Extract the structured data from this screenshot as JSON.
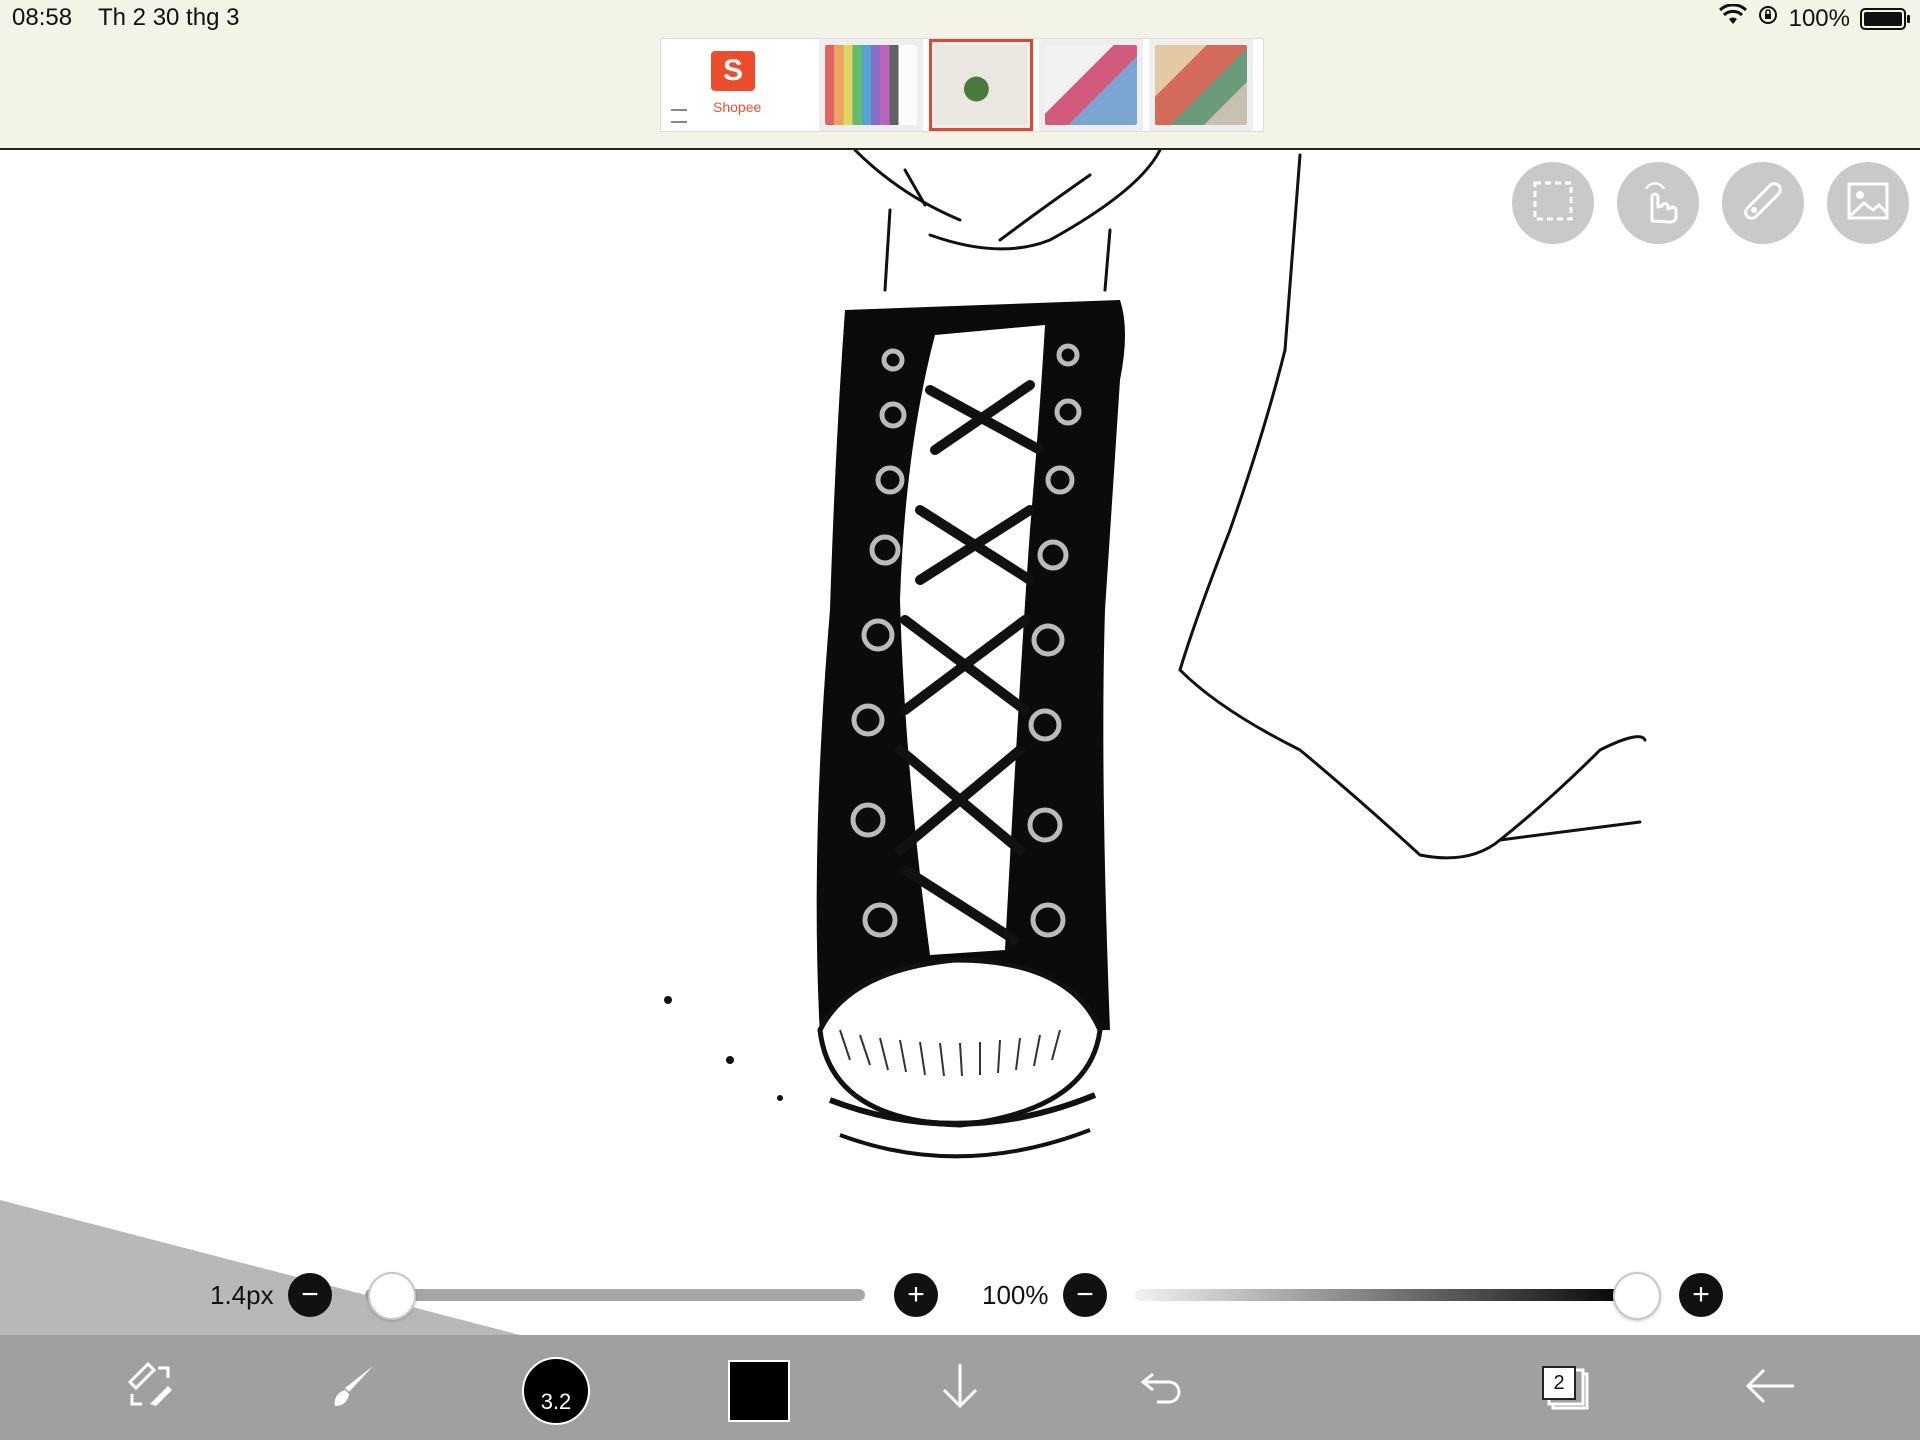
{
  "status_bar": {
    "time": "08:58",
    "date": "Th 2 30 thg 3",
    "battery_percent": "100%",
    "icons": [
      "wifi-icon",
      "orientation-lock-icon",
      "battery-icon"
    ]
  },
  "ad_banner": {
    "brand_label": "Shopee",
    "thumbnails": [
      {
        "name": "ad-thumb-1",
        "selected": false
      },
      {
        "name": "ad-thumb-2",
        "selected": true
      },
      {
        "name": "ad-thumb-3",
        "selected": false
      },
      {
        "name": "ad-thumb-4",
        "selected": false
      }
    ]
  },
  "canvas_tools": [
    "selection-icon",
    "gesture-icon",
    "ruler-icon",
    "image-icon"
  ],
  "brush": {
    "size_label": "1.4px",
    "size_level": 0.05,
    "opacity_label": "100%",
    "opacity_level": 1.0,
    "brush_size_badge": "3.2"
  },
  "toolbar": {
    "tools": [
      "transform-icon",
      "brush-icon",
      "brush-size",
      "color-swatch",
      "download-icon",
      "undo-icon",
      "layers-icon",
      "back-icon"
    ],
    "layer_count": "2",
    "color": "#000000"
  }
}
